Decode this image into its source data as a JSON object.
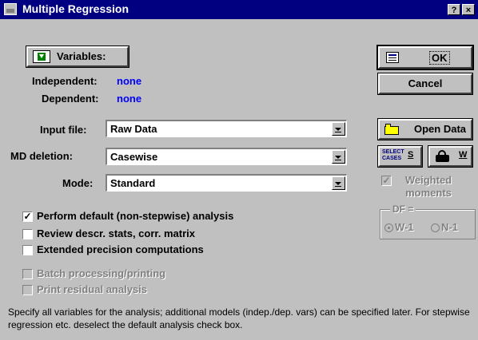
{
  "window": {
    "title": "Multiple Regression",
    "help_label": "?",
    "close_label": "×"
  },
  "variables_button": {
    "label": "Variables:",
    "mnemonic": "V"
  },
  "independent": {
    "label": "Independent:",
    "value": "none"
  },
  "dependent": {
    "label": "Dependent:",
    "value": "none"
  },
  "input_file": {
    "label": "Input file:",
    "value": "Raw Data"
  },
  "md_deletion": {
    "label": "MD deletion:",
    "value": "Casewise"
  },
  "mode": {
    "label": "Mode:",
    "value": "Standard"
  },
  "buttons": {
    "ok": "OK",
    "cancel": "Cancel",
    "open_data": "Open Data",
    "select_cases_icon_text": "SELECT CASES",
    "select_cases_key": "S",
    "weight_key": "W"
  },
  "weighted_moments": {
    "label": "Weighted moments",
    "checked": true,
    "enabled": false
  },
  "df": {
    "label": "DF =",
    "options": [
      "W-1",
      "N-1"
    ],
    "selected": "W-1",
    "enabled": false
  },
  "checkboxes": [
    {
      "label": "Perform default (non-stepwise) analysis",
      "checked": true,
      "enabled": true
    },
    {
      "label": "Review descr. stats, corr. matrix",
      "checked": false,
      "enabled": true
    },
    {
      "label": "Extended precision computations",
      "checked": false,
      "enabled": true
    },
    {
      "label": "Batch processing/printing",
      "checked": false,
      "enabled": false
    },
    {
      "label": "Print residual analysis",
      "checked": false,
      "enabled": false
    }
  ],
  "status_text": "Specify all variables for the analysis; additional models (indep./dep. vars) can be specified later.  For stepwise regression etc. deselect the default analysis check box.",
  "colors": {
    "titlebar": "#000080",
    "face": "#c0c0c0",
    "accent_value": "#0000ff"
  }
}
